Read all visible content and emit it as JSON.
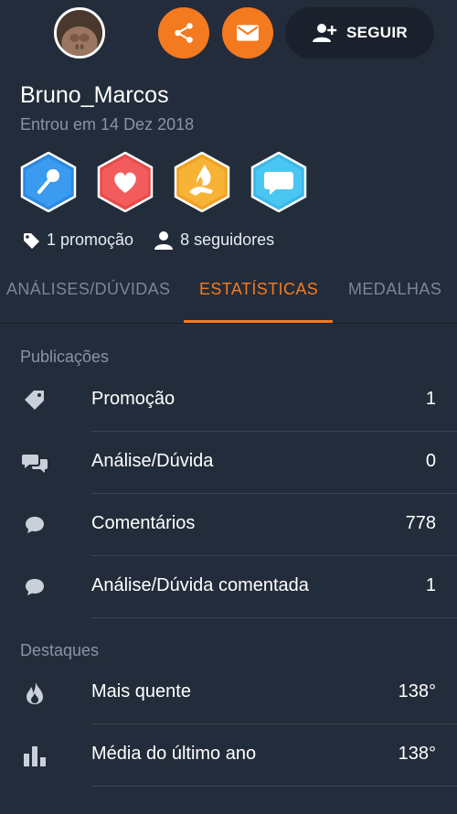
{
  "profile": {
    "username": "Bruno_Marcos",
    "joined": "Entrou em 14 Dez 2018",
    "follow_label": "SEGUIR",
    "avatar_icon": "user-avatar"
  },
  "counts": {
    "promotions": "1 promoção",
    "followers": "8 seguidores"
  },
  "badges": [
    {
      "icon": "microphone-icon",
      "color": "#2a8ae0"
    },
    {
      "icon": "heart-icon",
      "color": "#e84a4a"
    },
    {
      "icon": "flame-hand-icon",
      "color": "#f2a022"
    },
    {
      "icon": "chat-bubble-icon",
      "color": "#3bb8e8"
    }
  ],
  "tabs": {
    "analyses": "ANÁLISES/DÚVIDAS",
    "stats": "ESTATÍSTICAS",
    "medals": "MEDALHAS",
    "active": "stats"
  },
  "publications": {
    "title": "Publicações",
    "rows": [
      {
        "label": "Promoção",
        "value": "1",
        "icon": "tag-icon"
      },
      {
        "label": "Análise/Dúvida",
        "value": "0",
        "icon": "chat-bubbles-icon"
      },
      {
        "label": "Comentários",
        "value": "778",
        "icon": "comment-icon"
      },
      {
        "label": "Análise/Dúvida comentada",
        "value": "1",
        "icon": "comment-icon"
      }
    ]
  },
  "highlights": {
    "title": "Destaques",
    "rows": [
      {
        "label": "Mais quente",
        "value": "138°",
        "icon": "flame-icon"
      },
      {
        "label": "Média do último ano",
        "value": "138°",
        "icon": "bar-chart-icon"
      }
    ]
  },
  "colors": {
    "background": "#232c3a",
    "accent": "#f47a20",
    "muted_text": "#8894a6",
    "divider": "#3a4556"
  }
}
